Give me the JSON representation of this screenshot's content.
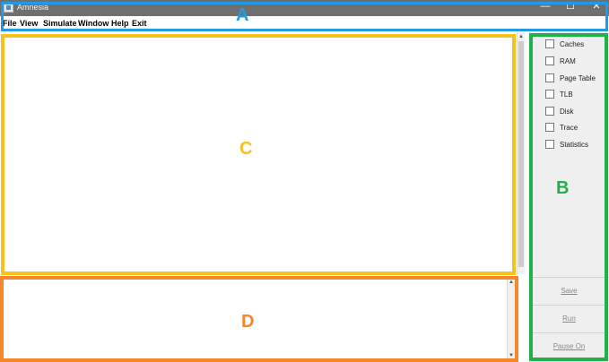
{
  "window": {
    "title": "Amnesia",
    "minimize": "—",
    "maximize": "☐",
    "close": "✕"
  },
  "menu": {
    "items": [
      "File",
      "View",
      "Simulate",
      "Window",
      "Help",
      "Exit"
    ]
  },
  "options": {
    "items": [
      "Caches",
      "RAM",
      "Page Table",
      "TLB",
      "Disk",
      "Trace",
      "Statistics"
    ]
  },
  "actions": {
    "save": "Save",
    "run": "Run",
    "pause": "Pause On"
  },
  "regions": {
    "a": {
      "letter": "A",
      "color": "#1f9be6"
    },
    "b": {
      "letter": "B",
      "color": "#22b04b"
    },
    "c": {
      "letter": "C",
      "color": "#f7c21b"
    },
    "d": {
      "letter": "D",
      "color": "#f5872b"
    }
  }
}
